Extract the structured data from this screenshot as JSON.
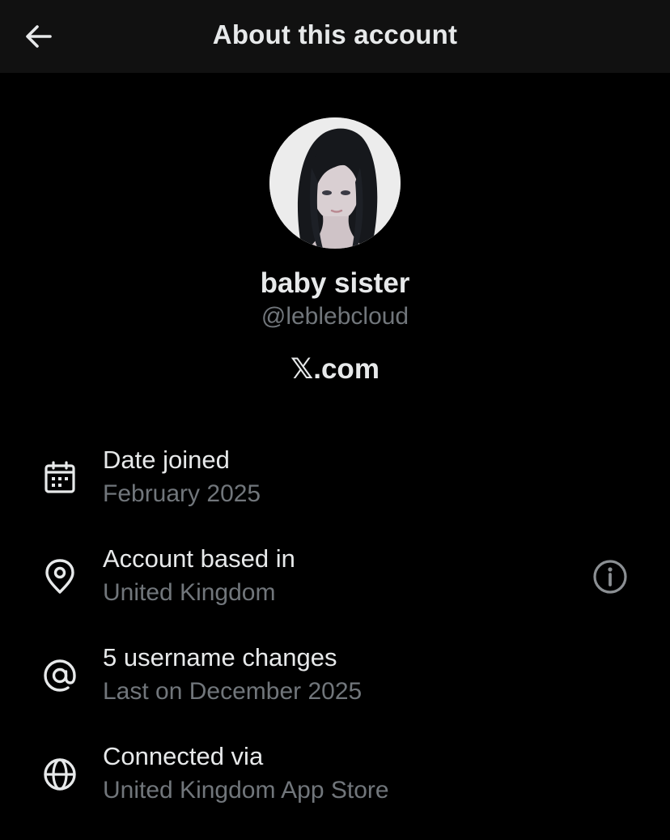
{
  "header": {
    "title": "About this account",
    "back_icon": "arrow-left-icon"
  },
  "profile": {
    "display_name": "baby sister",
    "handle": "@leblebcloud",
    "website": "𝕏.com"
  },
  "details": [
    {
      "icon": "calendar-icon",
      "title": "Date joined",
      "value": "February 2025"
    },
    {
      "icon": "location-pin-icon",
      "title": "Account based in",
      "value": "United Kingdom",
      "action_icon": "info-icon"
    },
    {
      "icon": "at-sign-icon",
      "title": "5 username changes",
      "value": "Last on December 2025"
    },
    {
      "icon": "globe-icon",
      "title": "Connected via",
      "value": "United Kingdom App Store"
    }
  ],
  "colors": {
    "background": "#000000",
    "header_background": "#111111",
    "primary_text": "#e7e9ea",
    "secondary_text": "#71767b"
  }
}
